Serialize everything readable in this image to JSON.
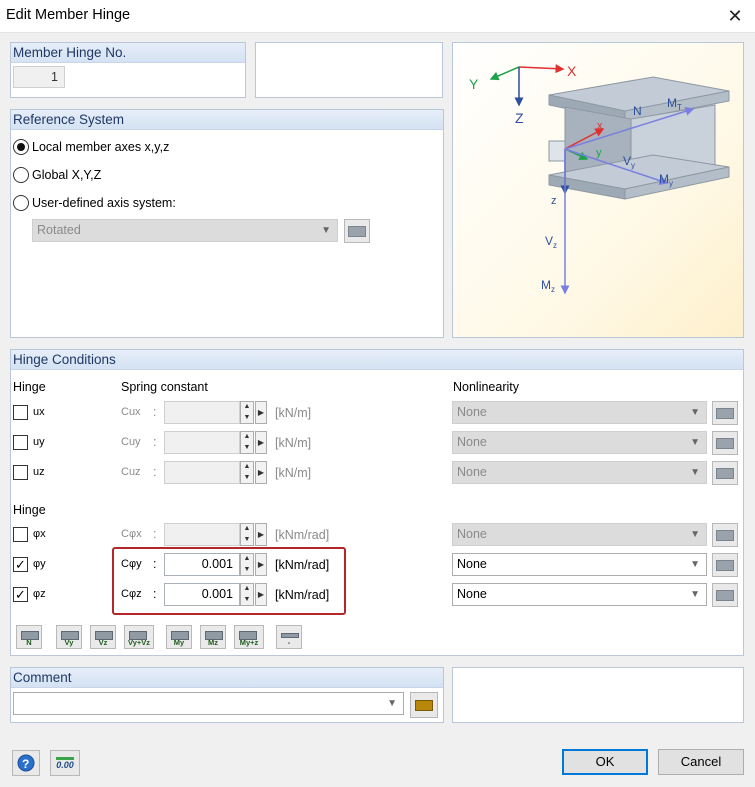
{
  "window": {
    "title": "Edit Member Hinge"
  },
  "hinge_no": {
    "label": "Member Hinge No.",
    "value": "1"
  },
  "reference_system": {
    "title": "Reference System",
    "options": [
      {
        "label": "Local member axes x,y,z",
        "selected": true
      },
      {
        "label": "Global X,Y,Z",
        "selected": false
      },
      {
        "label": "User-defined axis system:",
        "selected": false
      }
    ],
    "axis_system_value": "Rotated"
  },
  "diagram": {
    "global_axes": [
      "X",
      "Y",
      "Z"
    ],
    "member_labels": [
      "x",
      "y",
      "z",
      "N",
      "MT",
      "Vy",
      "My",
      "Vz",
      "Mz"
    ]
  },
  "hinge_conditions": {
    "title": "Hinge Conditions",
    "col_hinge": "Hinge",
    "col_spring": "Spring constant",
    "col_nonlinearity": "Nonlinearity",
    "translation_rows": [
      {
        "hinge": "ux",
        "checked": false,
        "spring": "Cux",
        "value": "",
        "unit": "[kN/m]",
        "nonlinearity": "None",
        "enabled": false
      },
      {
        "hinge": "uy",
        "checked": false,
        "spring": "Cuy",
        "value": "",
        "unit": "[kN/m]",
        "nonlinearity": "None",
        "enabled": false
      },
      {
        "hinge": "uz",
        "checked": false,
        "spring": "Cuz",
        "value": "",
        "unit": "[kN/m]",
        "nonlinearity": "None",
        "enabled": false
      }
    ],
    "rotation_header": "Hinge",
    "rotation_rows": [
      {
        "hinge": "φx",
        "checked": false,
        "spring": "Cφx",
        "value": "",
        "unit": "[kNm/rad]",
        "nonlinearity": "None",
        "enabled": false
      },
      {
        "hinge": "φy",
        "checked": true,
        "spring": "Cφy",
        "value": "0.001",
        "unit": "[kNm/rad]",
        "nonlinearity": "None",
        "enabled": true
      },
      {
        "hinge": "φz",
        "checked": true,
        "spring": "Cφz",
        "value": "0.001",
        "unit": "[kNm/rad]",
        "nonlinearity": "None",
        "enabled": true
      }
    ],
    "preset_buttons": [
      "N",
      "Vy",
      "Vz",
      "Vy+Vz",
      "My",
      "Mz",
      "My+z",
      "-"
    ]
  },
  "comment": {
    "title": "Comment",
    "value": ""
  },
  "buttons": {
    "ok": "OK",
    "cancel": "Cancel",
    "units_icon": "0.00"
  },
  "colors": {
    "accent": "#0078d7",
    "highlight_border": "#b3262b",
    "panel_header": "#dae6f4"
  }
}
